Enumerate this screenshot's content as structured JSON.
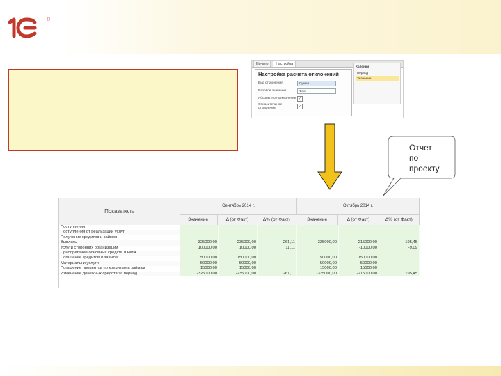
{
  "logo": {
    "text": "1С",
    "mark": "®"
  },
  "dialog": {
    "tabs": [
      {
        "label": "Начало",
        "active": false
      },
      {
        "label": "Настройка",
        "active": true
      }
    ],
    "title": "Настройка расчета отклонений",
    "fields": [
      {
        "label": "Вид отклонения",
        "type": "input",
        "value": "Сумма"
      },
      {
        "label": "Базовое значение",
        "type": "input",
        "value": "Факт"
      },
      {
        "label": "Абсолютное отклонение",
        "type": "check",
        "value": "✓"
      },
      {
        "label": "Относительное отклонение",
        "type": "check",
        "value": "✓"
      }
    ],
    "side": {
      "header": "Колонки",
      "items": [
        {
          "label": "Период",
          "selected": false
        },
        {
          "label": "Значение",
          "selected": true
        }
      ]
    }
  },
  "callout": {
    "lines": [
      "Отчет",
      "по",
      "проекту"
    ]
  },
  "report": {
    "header_indicator": "Показатель",
    "months": [
      "Сентябрь 2014 г.",
      "Октябрь 2014 г."
    ],
    "subcolumns": [
      "Значение",
      "Δ (от Факт)",
      "Δ% (от Факт)"
    ],
    "rows": [
      {
        "name": "Поступления",
        "v": [
          "",
          "",
          "",
          "",
          "",
          ""
        ]
      },
      {
        "name": "Поступления от реализации услуг",
        "v": [
          "",
          "",
          "",
          "",
          "",
          ""
        ]
      },
      {
        "name": "Получение кредитов и займов",
        "v": [
          "",
          "",
          "",
          "",
          "",
          ""
        ]
      },
      {
        "name": "Выплаты",
        "v": [
          "325000,00",
          "235000,00",
          "261,11",
          "325000,00",
          "215000,00",
          "195,45"
        ]
      },
      {
        "name": "Услуги сторонних организаций",
        "v": [
          "100000,00",
          "10000,00",
          "11,11",
          "",
          "-10000,00",
          "-9,09"
        ]
      },
      {
        "name": "Приобретение основных средств и НМА",
        "v": [
          "",
          "",
          "",
          "",
          "",
          ""
        ]
      },
      {
        "name": "Погашение кредитов и займов",
        "v": [
          "50000,00",
          "150000,00",
          "",
          "150000,00",
          "150000,00",
          ""
        ]
      },
      {
        "name": "Материалы и услуги",
        "v": [
          "50000,00",
          "50000,00",
          "",
          "50000,00",
          "50000,00",
          ""
        ]
      },
      {
        "name": "Погашение процентов по кредитам и займам",
        "v": [
          "15000,00",
          "15000,00",
          "",
          "15000,00",
          "15000,00",
          ""
        ]
      },
      {
        "name": "Изменение денежных средств за период",
        "v": [
          "-325000,00",
          "-235000,00",
          "261,11",
          "-325000,00",
          "-215000,00",
          "195,45"
        ]
      }
    ]
  },
  "colors": {
    "note_bg": "#fcf7c9",
    "note_border": "#c0392b",
    "arrow": "#f2c21b",
    "logo": "#c0392b",
    "value_bg": "#e7f6e1"
  }
}
